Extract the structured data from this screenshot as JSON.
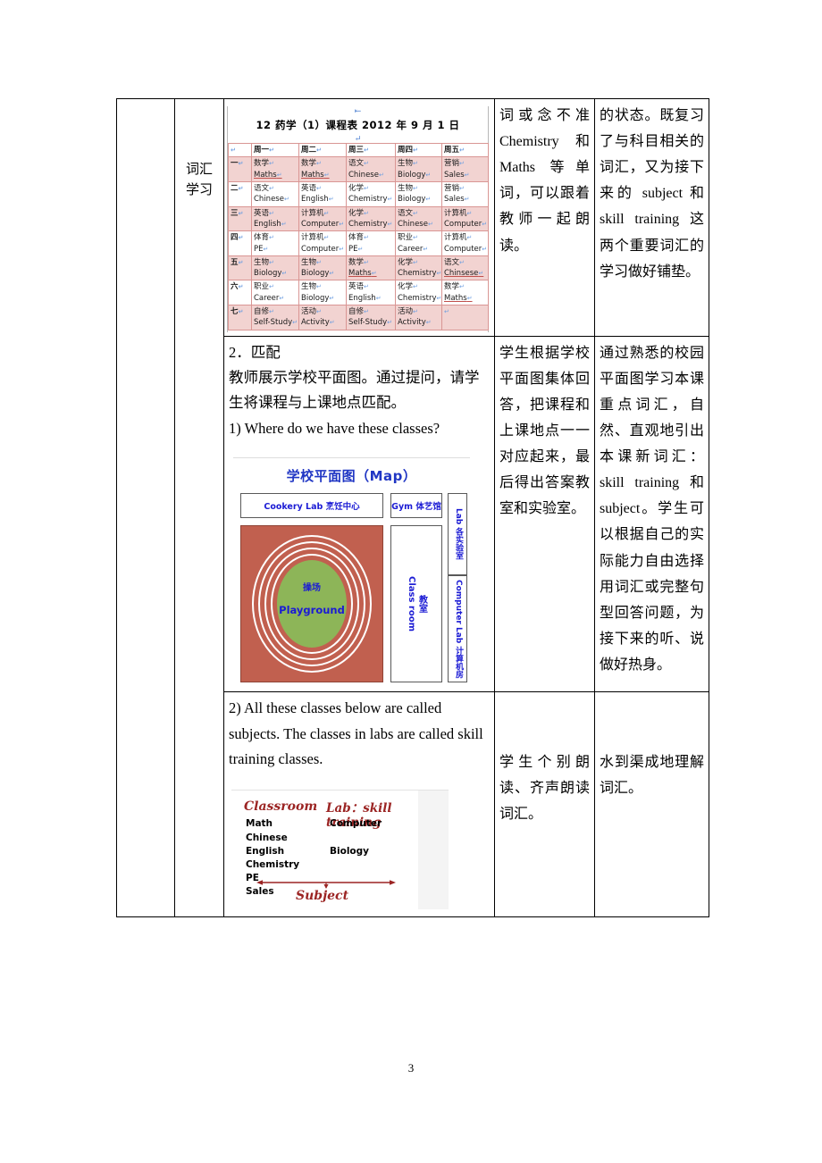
{
  "page": {
    "number": "3"
  },
  "lesson_table": {
    "stage_label_line1": "词汇",
    "stage_label_line2": "学习",
    "rows": [
      {
        "procedure_note": "",
        "student_activity": "词或念不准 Chemistry 和 Maths 等单词，可以跟着教师一起朗读。",
        "design_intent": "的状态。既复习了与科目相关的词汇，又为接下来的 subject 和 skill training 这两个重要词汇的学习做好铺垫。"
      },
      {
        "heading": "2．匹配",
        "teacher_text": "教师展示学校平面图。通过提问，请学生将课程与上课地点匹配。",
        "question1": "1) Where do we have these classes?",
        "student_activity": "学生根据学校平面图集体回答，把课程和上课地点一一对应起来，最后得出答案教室和实验室。",
        "design_intent": "通过熟悉的校园平面图学习本课重点词汇，自然、直观地引出本课新词汇：skill training 和 subject。学生可以根据自己的实际能力自由选择用词汇或完整句型回答问题，为接下来的听、说做好热身。"
      },
      {
        "question2": "2) All these classes below are called subjects. The classes in labs are called skill training classes.",
        "student_activity": "学生个别朗读、齐声朗读词汇。",
        "design_intent": "水到渠成地理解词汇。"
      }
    ]
  },
  "schedule_image": {
    "title": "12 药学（1）课程表  2012 年 9 月 1 日",
    "column_headers": [
      "",
      "周一",
      "周二",
      "周三",
      "周四",
      "周五"
    ],
    "rows": [
      {
        "index": "一",
        "cells": [
          {
            "cn": "数学",
            "en": "Maths",
            "underline": true
          },
          {
            "cn": "数学",
            "en": "Maths",
            "underline": true
          },
          {
            "cn": "语文",
            "en": "Chinese",
            "underline": false
          },
          {
            "cn": "生物",
            "en": "Biology",
            "underline": false
          },
          {
            "cn": "营销",
            "en": "Sales",
            "underline": false
          }
        ]
      },
      {
        "index": "二",
        "cells": [
          {
            "cn": "语文",
            "en": "Chinese",
            "underline": false
          },
          {
            "cn": "英语",
            "en": "English",
            "underline": false
          },
          {
            "cn": "化学",
            "en": "Chemistry",
            "underline": false
          },
          {
            "cn": "生物",
            "en": "Biology",
            "underline": false
          },
          {
            "cn": "营销",
            "en": "Sales",
            "underline": false
          }
        ]
      },
      {
        "index": "三",
        "cells": [
          {
            "cn": "英语",
            "en": "English",
            "underline": false
          },
          {
            "cn": "计算机",
            "en": "Computer",
            "underline": false
          },
          {
            "cn": "化学",
            "en": "Chemistry",
            "underline": false
          },
          {
            "cn": "语文",
            "en": "Chinese",
            "underline": false
          },
          {
            "cn": "计算机",
            "en": "Computer",
            "underline": false
          }
        ]
      },
      {
        "index": "四",
        "cells": [
          {
            "cn": "体育",
            "en": "PE",
            "underline": false
          },
          {
            "cn": "计算机",
            "en": "Computer",
            "underline": false
          },
          {
            "cn": "体育",
            "en": "PE",
            "underline": false
          },
          {
            "cn": "职业",
            "en": "Career",
            "underline": false
          },
          {
            "cn": "计算机",
            "en": "Computer",
            "underline": false
          }
        ]
      },
      {
        "index": "五",
        "cells": [
          {
            "cn": "生物",
            "en": "Biology",
            "underline": false
          },
          {
            "cn": "生物",
            "en": "Biology",
            "underline": false
          },
          {
            "cn": "数学",
            "en": "Maths",
            "underline": true
          },
          {
            "cn": "化学",
            "en": "Chemistry",
            "underline": false
          },
          {
            "cn": "语文",
            "en": "Chinsese",
            "underline": true
          }
        ]
      },
      {
        "index": "六",
        "cells": [
          {
            "cn": "职业",
            "en": "Career",
            "underline": false
          },
          {
            "cn": "生物",
            "en": "Biology",
            "underline": false
          },
          {
            "cn": "英语",
            "en": "English",
            "underline": false
          },
          {
            "cn": "化学",
            "en": "Chemistry",
            "underline": false
          },
          {
            "cn": "数学",
            "en": "Maths",
            "underline": true
          }
        ]
      },
      {
        "index": "七",
        "cells": [
          {
            "cn": "自修",
            "en": "Self-Study",
            "underline": false
          },
          {
            "cn": "活动",
            "en": "Activity",
            "underline": false
          },
          {
            "cn": "自修",
            "en": "Self-Study",
            "underline": false
          },
          {
            "cn": "活动",
            "en": "Activity",
            "underline": false
          },
          {
            "cn": "",
            "en": "",
            "underline": false
          }
        ]
      }
    ]
  },
  "map_image": {
    "title_cn": "学校平面图",
    "title_en": "（Map）",
    "boxes": {
      "cookery": "Cookery Lab 烹饪中心",
      "gym": "Gym 体艺馆",
      "labs": "Lab 各实验室",
      "computer_lab": "Computer Lab 计算机房",
      "classroom_en": "Class room",
      "classroom_cn": "教室",
      "playground_cn": "操场",
      "playground_en": "Playground"
    },
    "colors": {
      "title": "#2036c4",
      "label": "#1b1bd4",
      "track": "#c1604f",
      "infield": "#8db558"
    }
  },
  "subject_image": {
    "heading_left": "Classroom",
    "heading_right": "Lab：skill training",
    "classroom_items": [
      "Math",
      "Chinese",
      "English",
      "Chemistry",
      "PE",
      "Sales"
    ],
    "lab_items": [
      "Computer",
      "",
      "Biology"
    ],
    "arrow_label": "Subject",
    "accent_color": "#9b2423"
  }
}
